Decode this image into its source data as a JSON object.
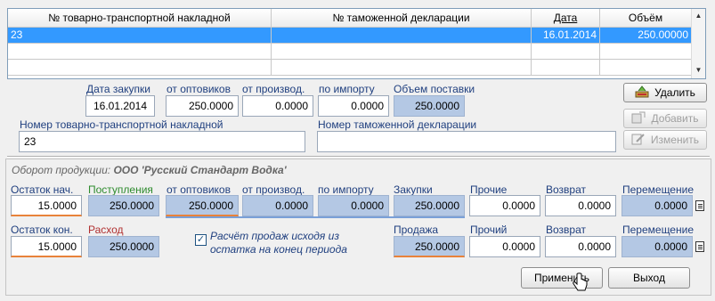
{
  "grid": {
    "headers": [
      "№ товарно-транспортной накладной",
      "№ таможенной декларации",
      "Дата",
      "Объём"
    ],
    "rows": [
      [
        "23",
        "",
        "16.01.2014",
        "250.00000"
      ],
      [
        "",
        "",
        "",
        ""
      ],
      [
        "",
        "",
        "",
        ""
      ]
    ]
  },
  "purchase": {
    "date_label": "Дата закупки",
    "date_value": "16.01.2014",
    "wholesale_label": "от оптовиков",
    "wholesale_value": "250.0000",
    "producer_label": "от производ.",
    "producer_value": "0.0000",
    "import_label": "по импорту",
    "import_value": "0.0000",
    "volume_label": "Объем поставки",
    "volume_value": "250.0000",
    "waybill_label": "Номер товарно-транспортной накладной",
    "waybill_value": "23",
    "customs_label": "Номер таможенной декларации",
    "customs_value": ""
  },
  "buttons": {
    "delete": "Удалить",
    "add": "Добавить",
    "edit": "Изменить",
    "apply": "Применить",
    "exit": "Выход"
  },
  "turnover": {
    "title_prefix": "Оборот продукции:",
    "company": "ООО 'Русский Стандарт Водка'",
    "row1": {
      "start_label": "Остаток нач.",
      "start_value": "15.0000",
      "income_label": "Поступления",
      "income_value": "250.0000",
      "wholesale_label": "от оптовиков",
      "wholesale_value": "250.0000",
      "producer_label": "от производ.",
      "producer_value": "0.0000",
      "import_label": "по импорту",
      "import_value": "0.0000",
      "purchases_label": "Закупки",
      "purchases_value": "250.0000",
      "other_label": "Прочие",
      "other_value": "0.0000",
      "return_label": "Возврат",
      "return_value": "0.0000",
      "move_label": "Перемещение",
      "move_value": "0.0000"
    },
    "row2": {
      "end_label": "Остаток кон.",
      "end_value": "15.0000",
      "expense_label": "Расход",
      "expense_value": "250.0000",
      "checkbox_label_1": "Расчёт продаж исходя из",
      "checkbox_label_2": "остатка на конец периода",
      "checkbox_checked": true,
      "sales_label": "Продажа",
      "sales_value": "250.0000",
      "other_label": "Прочий",
      "other_value": "0.0000",
      "return_label": "Возврат",
      "return_value": "0.0000",
      "move_label": "Перемещение",
      "move_value": "0.0000"
    }
  },
  "colors": {
    "selection": "#3399ff",
    "readonly_field": "#b4c8e4",
    "label_blue": "#1f3f7f",
    "accent_orange": "#e8823a"
  }
}
